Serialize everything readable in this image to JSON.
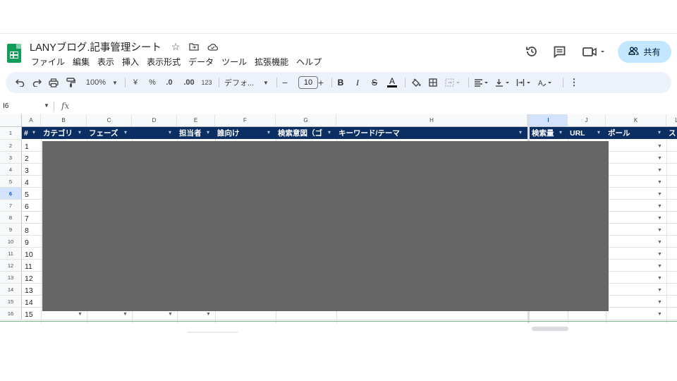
{
  "doc": {
    "title": "LANYブログ.記事管理シート"
  },
  "menu": [
    "ファイル",
    "編集",
    "表示",
    "挿入",
    "表示形式",
    "データ",
    "ツール",
    "拡張機能",
    "ヘルプ"
  ],
  "title_icons": [
    "star-icon",
    "move-folder-icon",
    "cloud-status-icon"
  ],
  "header_actions": {
    "history_icon": "history-icon",
    "comment_icon": "comment-icon",
    "meet_icon": "video-call-icon",
    "share_label": "共有"
  },
  "toolbar": {
    "zoom": "100%",
    "currency": "¥",
    "percent": "%",
    "dec_decrease": ".0",
    "dec_increase": ".00",
    "format_number": "123",
    "font": "デフォ...",
    "font_size": "10",
    "minus": "−",
    "plus": "+",
    "bold": "B",
    "italic": "I",
    "strike": "S",
    "text_color": "A"
  },
  "formula_bar": {
    "name_box": "I6",
    "fx": "fx",
    "formula": ""
  },
  "grid": {
    "columns": [
      "A",
      "B",
      "C",
      "D",
      "E",
      "F",
      "G",
      "H",
      "I",
      "J",
      "K",
      "L"
    ],
    "selected_column": "I",
    "row_numbers": [
      "1",
      "2",
      "3",
      "4",
      "5",
      "6",
      "7",
      "8",
      "9",
      "10",
      "11",
      "12",
      "13",
      "14",
      "15",
      "16"
    ],
    "selected_row": "6",
    "headers": [
      "#",
      "カテゴリ",
      "フェーズ",
      "担当者",
      "誰向け",
      "検索意図（ゴ",
      "キーワード/テーマ",
      "検索量",
      "URL",
      "ポール",
      "ス"
    ],
    "item_numbers": [
      "1",
      "2",
      "3",
      "4",
      "5",
      "6",
      "7",
      "8",
      "9",
      "10",
      "11",
      "12",
      "13",
      "14",
      "15"
    ]
  },
  "colors": {
    "header_band": "#0b2f63",
    "share_button": "#c2e7ff",
    "toolbar_bg": "#edf2fa",
    "redaction": "#666666",
    "sheets_green": "#0f9d58"
  }
}
